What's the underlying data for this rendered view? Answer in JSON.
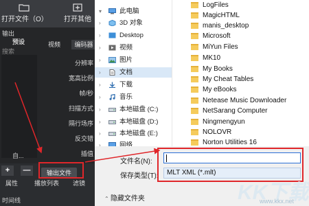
{
  "editor": {
    "toolbar": [
      {
        "label": "打开文件（O）",
        "icon": "folder-open-icon"
      },
      {
        "label": "打开其他",
        "icon": "open-other-icon"
      }
    ],
    "output_label": "输出",
    "preset_label": "预设",
    "search_placeholder": "搜索",
    "tabs": [
      "视频",
      "编码器"
    ],
    "properties": [
      "分辨率",
      "宽高比例",
      "帧/秒",
      "扫描方式",
      "隔行场序",
      "反交错",
      "插值"
    ],
    "preset_item": "自...",
    "add_symbol": "+",
    "remove_symbol": "—",
    "export_button": "输出文件",
    "bottom_tabs": [
      "属性",
      "播放列表",
      "滤镜"
    ],
    "timeline_label": "时间线"
  },
  "dialog": {
    "nav_items": [
      {
        "label": "此电脑",
        "icon": "computer-icon"
      },
      {
        "label": "3D 对象",
        "icon": "3d-objects-icon"
      },
      {
        "label": "Desktop",
        "icon": "desktop-icon"
      },
      {
        "label": "视频",
        "icon": "video-icon"
      },
      {
        "label": "图片",
        "icon": "picture-icon"
      },
      {
        "label": "文档",
        "icon": "document-icon"
      },
      {
        "label": "下载",
        "icon": "download-icon"
      },
      {
        "label": "音乐",
        "icon": "music-icon"
      },
      {
        "label": "本地磁盘 (C:)",
        "icon": "drive-icon"
      },
      {
        "label": "本地磁盘 (D:)",
        "icon": "drive-icon"
      },
      {
        "label": "本地磁盘 (E:)",
        "icon": "drive-icon"
      },
      {
        "label": "网络",
        "icon": "network-icon"
      }
    ],
    "folders": [
      "LogFiles",
      "MagicHTML",
      "manis_desktop",
      "Microsoft",
      "MiYun Files",
      "MK10",
      "My Books",
      "My Cheat Tables",
      "My eBooks",
      "Netease Music Downloader",
      "NetSarang Computer",
      "Ningmengyun",
      "NOLOVR",
      "Norton Utilities 16"
    ],
    "filename_label": "文件名(N):",
    "filename_value": "",
    "savetype_label": "保存类型(T):",
    "savetype_value": "MLT XML (*.mlt)",
    "hide_folders_label": "隐藏文件夹"
  },
  "watermark": {
    "logo": "KK下载",
    "url": "www.kkx.net"
  },
  "colors": {
    "highlight": "#e0262a",
    "selection": "#d9e8f7",
    "folder": "#f5cb5c",
    "editor_bg": "#2b2d30"
  }
}
